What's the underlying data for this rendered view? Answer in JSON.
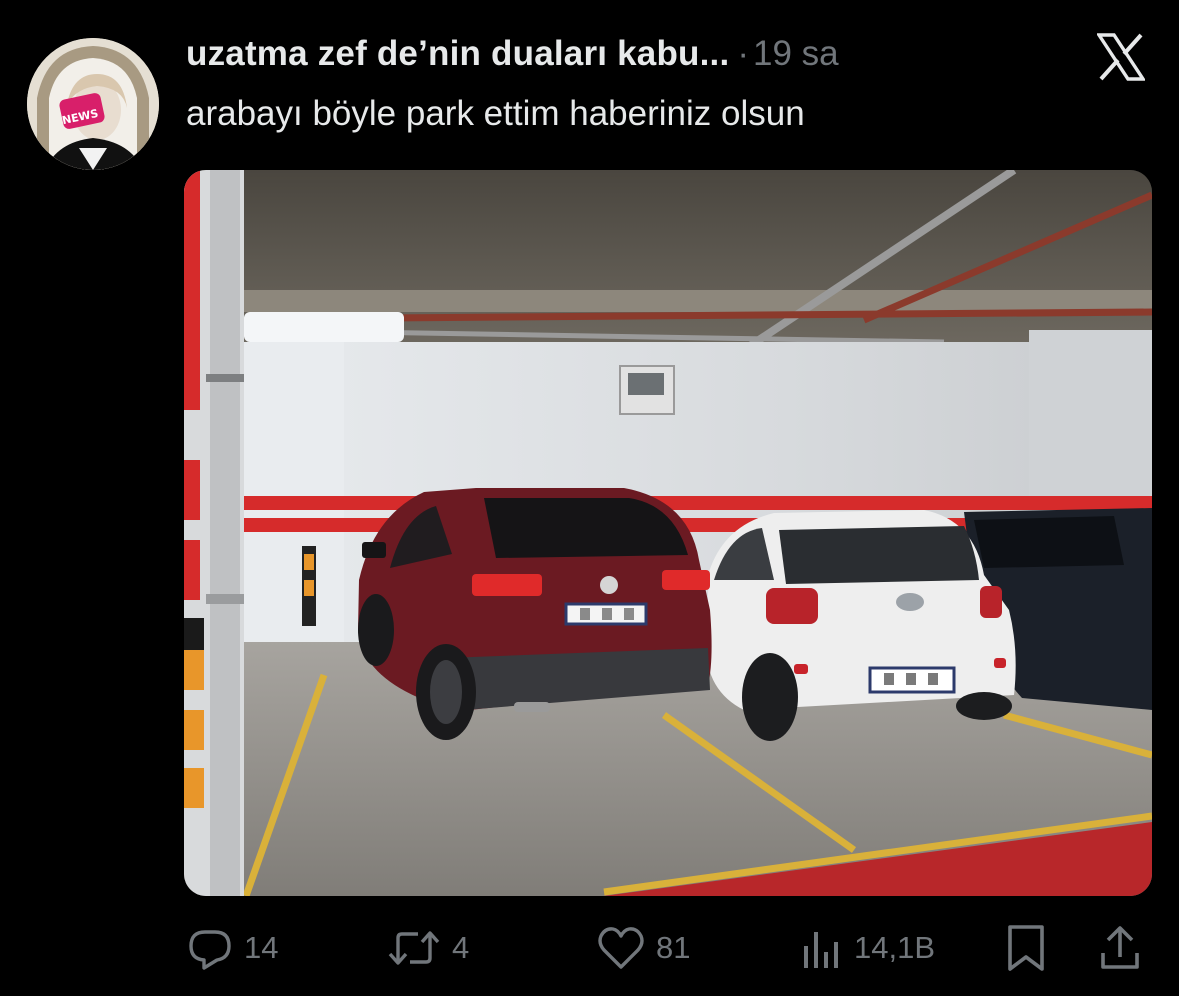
{
  "post": {
    "author_name": "uzatma zef de’nin duaları kabu...",
    "separator": "·",
    "time": "19 sa",
    "text": "arabayı böyle park ettim haberiniz olsun",
    "avatar_badge": "NEWS",
    "image_description": "",
    "media_alt": "photo"
  },
  "actions": {
    "reply_count": "14",
    "repost_count": "4",
    "like_count": "81",
    "views_count": "14,1B"
  },
  "icons": {
    "platform": "x-logo-icon",
    "reply": "speech-bubble-icon",
    "repost": "repost-arrows-icon",
    "like": "heart-icon",
    "views": "bar-chart-icon",
    "bookmark": "bookmark-icon",
    "share": "share-upload-icon"
  },
  "colors": {
    "background": "#000000",
    "primary_text": "#e7e9ea",
    "secondary_text": "#71767b",
    "wall_stripe": "#d62b2b",
    "floor_line": "#d9b13a"
  }
}
